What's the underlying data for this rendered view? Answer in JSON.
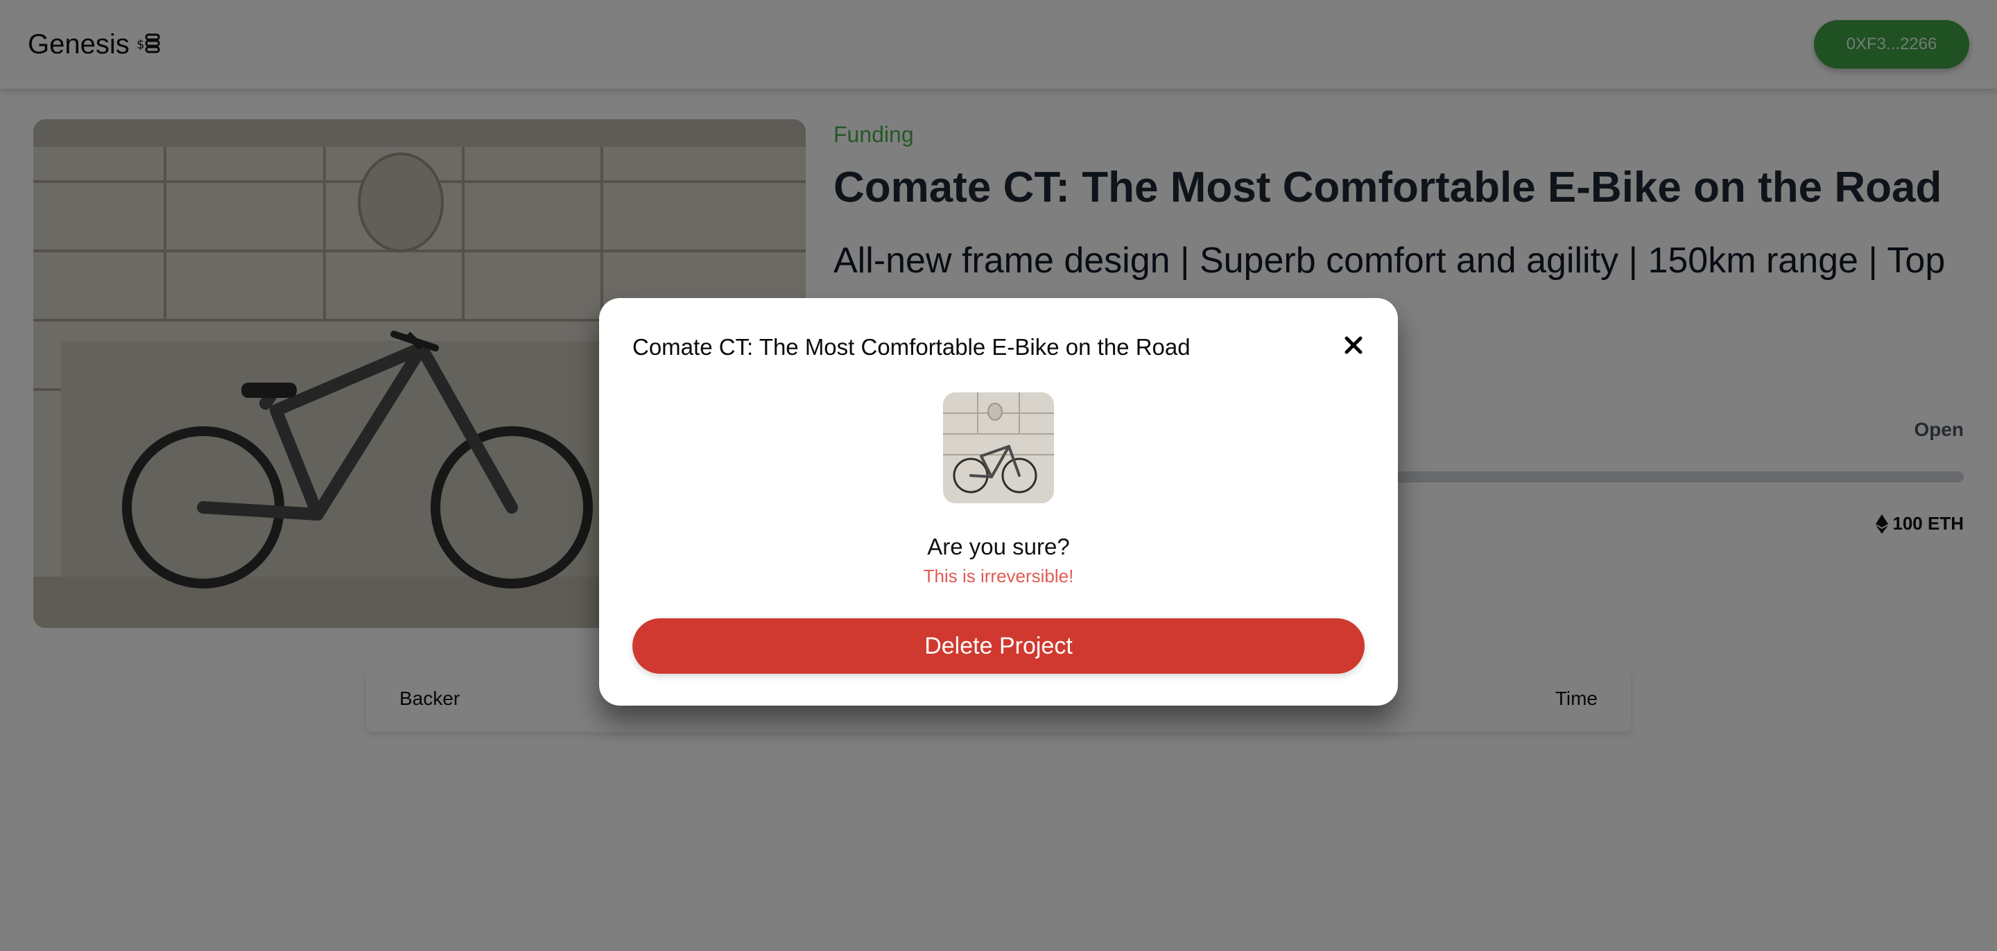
{
  "header": {
    "brand": "Genesis",
    "wallet_address": "0XF3...2266"
  },
  "project": {
    "status": "Funding",
    "title": "Comate CT: The Most Comfortable E-Bike on the Road",
    "subtitle": "All-new frame design | Superb comfort and agility | 150km range | Top",
    "state_label": "Open",
    "goal": "100 ETH",
    "progress_fraction": 0.0
  },
  "backers_table": {
    "columns": [
      "Backer",
      "Time"
    ]
  },
  "modal": {
    "title": "Comate CT: The Most Comfortable E-Bike on the Road",
    "question": "Are you sure?",
    "warning": "This is irreversible!",
    "delete_label": "Delete Project"
  },
  "colors": {
    "accent": "#3fa344",
    "danger": "#d0392f",
    "warning_text": "#e25b53"
  },
  "icons": {
    "brand": "coins-icon",
    "close": "close-icon",
    "currency": "ethereum-icon"
  }
}
